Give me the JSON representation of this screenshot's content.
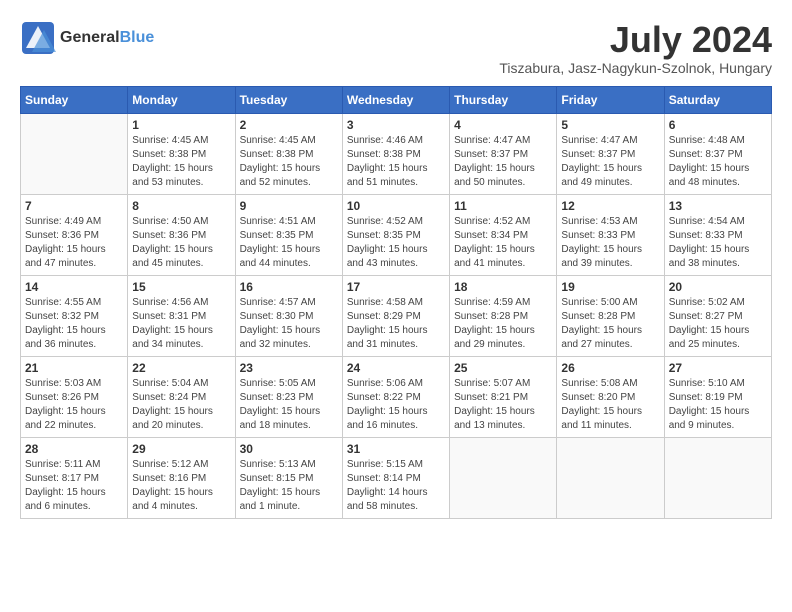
{
  "header": {
    "logo_general": "General",
    "logo_blue": "Blue",
    "month": "July 2024",
    "location": "Tiszabura, Jasz-Nagykun-Szolnok, Hungary"
  },
  "columns": [
    "Sunday",
    "Monday",
    "Tuesday",
    "Wednesday",
    "Thursday",
    "Friday",
    "Saturday"
  ],
  "weeks": [
    [
      {
        "day": "",
        "info": ""
      },
      {
        "day": "1",
        "info": "Sunrise: 4:45 AM\nSunset: 8:38 PM\nDaylight: 15 hours\nand 53 minutes."
      },
      {
        "day": "2",
        "info": "Sunrise: 4:45 AM\nSunset: 8:38 PM\nDaylight: 15 hours\nand 52 minutes."
      },
      {
        "day": "3",
        "info": "Sunrise: 4:46 AM\nSunset: 8:38 PM\nDaylight: 15 hours\nand 51 minutes."
      },
      {
        "day": "4",
        "info": "Sunrise: 4:47 AM\nSunset: 8:37 PM\nDaylight: 15 hours\nand 50 minutes."
      },
      {
        "day": "5",
        "info": "Sunrise: 4:47 AM\nSunset: 8:37 PM\nDaylight: 15 hours\nand 49 minutes."
      },
      {
        "day": "6",
        "info": "Sunrise: 4:48 AM\nSunset: 8:37 PM\nDaylight: 15 hours\nand 48 minutes."
      }
    ],
    [
      {
        "day": "7",
        "info": "Sunrise: 4:49 AM\nSunset: 8:36 PM\nDaylight: 15 hours\nand 47 minutes."
      },
      {
        "day": "8",
        "info": "Sunrise: 4:50 AM\nSunset: 8:36 PM\nDaylight: 15 hours\nand 45 minutes."
      },
      {
        "day": "9",
        "info": "Sunrise: 4:51 AM\nSunset: 8:35 PM\nDaylight: 15 hours\nand 44 minutes."
      },
      {
        "day": "10",
        "info": "Sunrise: 4:52 AM\nSunset: 8:35 PM\nDaylight: 15 hours\nand 43 minutes."
      },
      {
        "day": "11",
        "info": "Sunrise: 4:52 AM\nSunset: 8:34 PM\nDaylight: 15 hours\nand 41 minutes."
      },
      {
        "day": "12",
        "info": "Sunrise: 4:53 AM\nSunset: 8:33 PM\nDaylight: 15 hours\nand 39 minutes."
      },
      {
        "day": "13",
        "info": "Sunrise: 4:54 AM\nSunset: 8:33 PM\nDaylight: 15 hours\nand 38 minutes."
      }
    ],
    [
      {
        "day": "14",
        "info": "Sunrise: 4:55 AM\nSunset: 8:32 PM\nDaylight: 15 hours\nand 36 minutes."
      },
      {
        "day": "15",
        "info": "Sunrise: 4:56 AM\nSunset: 8:31 PM\nDaylight: 15 hours\nand 34 minutes."
      },
      {
        "day": "16",
        "info": "Sunrise: 4:57 AM\nSunset: 8:30 PM\nDaylight: 15 hours\nand 32 minutes."
      },
      {
        "day": "17",
        "info": "Sunrise: 4:58 AM\nSunset: 8:29 PM\nDaylight: 15 hours\nand 31 minutes."
      },
      {
        "day": "18",
        "info": "Sunrise: 4:59 AM\nSunset: 8:28 PM\nDaylight: 15 hours\nand 29 minutes."
      },
      {
        "day": "19",
        "info": "Sunrise: 5:00 AM\nSunset: 8:28 PM\nDaylight: 15 hours\nand 27 minutes."
      },
      {
        "day": "20",
        "info": "Sunrise: 5:02 AM\nSunset: 8:27 PM\nDaylight: 15 hours\nand 25 minutes."
      }
    ],
    [
      {
        "day": "21",
        "info": "Sunrise: 5:03 AM\nSunset: 8:26 PM\nDaylight: 15 hours\nand 22 minutes."
      },
      {
        "day": "22",
        "info": "Sunrise: 5:04 AM\nSunset: 8:24 PM\nDaylight: 15 hours\nand 20 minutes."
      },
      {
        "day": "23",
        "info": "Sunrise: 5:05 AM\nSunset: 8:23 PM\nDaylight: 15 hours\nand 18 minutes."
      },
      {
        "day": "24",
        "info": "Sunrise: 5:06 AM\nSunset: 8:22 PM\nDaylight: 15 hours\nand 16 minutes."
      },
      {
        "day": "25",
        "info": "Sunrise: 5:07 AM\nSunset: 8:21 PM\nDaylight: 15 hours\nand 13 minutes."
      },
      {
        "day": "26",
        "info": "Sunrise: 5:08 AM\nSunset: 8:20 PM\nDaylight: 15 hours\nand 11 minutes."
      },
      {
        "day": "27",
        "info": "Sunrise: 5:10 AM\nSunset: 8:19 PM\nDaylight: 15 hours\nand 9 minutes."
      }
    ],
    [
      {
        "day": "28",
        "info": "Sunrise: 5:11 AM\nSunset: 8:17 PM\nDaylight: 15 hours\nand 6 minutes."
      },
      {
        "day": "29",
        "info": "Sunrise: 5:12 AM\nSunset: 8:16 PM\nDaylight: 15 hours\nand 4 minutes."
      },
      {
        "day": "30",
        "info": "Sunrise: 5:13 AM\nSunset: 8:15 PM\nDaylight: 15 hours\nand 1 minute."
      },
      {
        "day": "31",
        "info": "Sunrise: 5:15 AM\nSunset: 8:14 PM\nDaylight: 14 hours\nand 58 minutes."
      },
      {
        "day": "",
        "info": ""
      },
      {
        "day": "",
        "info": ""
      },
      {
        "day": "",
        "info": ""
      }
    ]
  ]
}
